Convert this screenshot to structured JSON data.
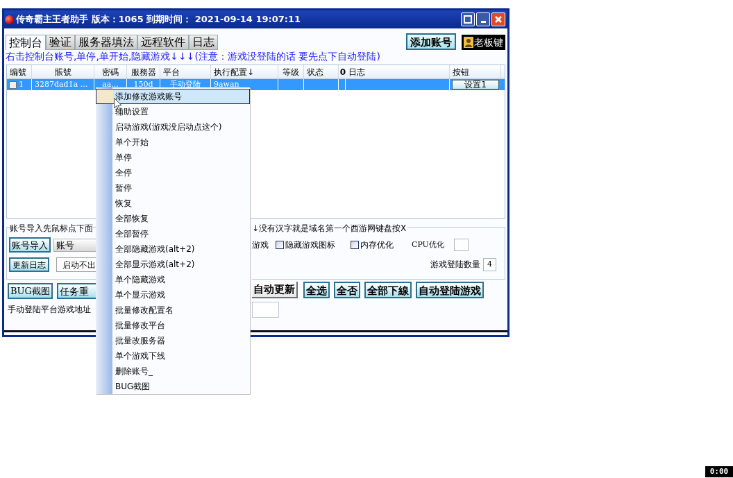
{
  "window": {
    "title": "传奇霸主王者助手 版本：1065 到期时间： 2021-09-14 19:07:11"
  },
  "tabs": [
    {
      "label": "控制台",
      "selected": true
    },
    {
      "label": "验证",
      "selected": false
    },
    {
      "label": "服务器填法",
      "selected": false
    },
    {
      "label": "远程软件",
      "selected": false
    },
    {
      "label": "日志",
      "selected": false
    }
  ],
  "add_account_button": "添加账号",
  "boss_key_button": "老板键",
  "notice": "右击控制台账号,单停,单开始,隐藏游戏↓↓↓(注意：游戏没登陆的话 要先点下自动登陆)",
  "table": {
    "columns": [
      "编號",
      "賬號",
      "密碼",
      "服務器",
      "平台",
      "执行配置↓",
      "等级",
      "状态",
      "0",
      "日志",
      "按钮"
    ],
    "rows": [
      {
        "selected": true,
        "checked": false,
        "cells": [
          "1",
          "3287dad1a ...",
          "aa...",
          "150d",
          "手动登陆",
          "9awan",
          "",
          "",
          "",
          ""
        ],
        "button": "设置1"
      }
    ]
  },
  "left_panel": {
    "group_title": "账号导入先鼠标点下面",
    "import_button": "账号导入",
    "account_combo": "账号",
    "update_log_button": "更新日志",
    "start_button": "启动不出",
    "bug_button": "BUG截图",
    "task_button": "任务重",
    "address_label": "手动登陆平台游戏地址"
  },
  "right_panel": {
    "group_title": "↓没有汉字就是域名第一个西游网键盘按X",
    "cut_label": "游戏",
    "options": [
      {
        "label": "隐藏游戏图标",
        "checked": false
      },
      {
        "label": "内存优化",
        "checked": false
      }
    ],
    "cpu_label": "CPU优化",
    "login_count_label": "游戏登陆数量",
    "login_count": "4",
    "buttons": [
      {
        "label": "自动更新",
        "kind": "plain"
      },
      {
        "label": "全选",
        "kind": "cyan"
      },
      {
        "label": "全否",
        "kind": "cyan"
      },
      {
        "label": "全部下線",
        "kind": "cyan"
      },
      {
        "label": "自动登陆游戏",
        "kind": "cyan"
      }
    ]
  },
  "context_menu": [
    {
      "label": "添加修改游戏账号",
      "selected": true
    },
    {
      "label": "辅助设置",
      "selected": false
    },
    {
      "label": "启动游戏(游戏没启动点这个)",
      "selected": false
    },
    {
      "label": "单个开始",
      "selected": false
    },
    {
      "label": "单停",
      "selected": false
    },
    {
      "label": "全停",
      "selected": false
    },
    {
      "label": "暂停",
      "selected": false
    },
    {
      "label": "恢复",
      "selected": false
    },
    {
      "label": "全部恢复",
      "selected": false
    },
    {
      "label": "全部暂停",
      "selected": false
    },
    {
      "label": "全部隐藏游戏(alt+2)",
      "selected": false
    },
    {
      "label": "全部显示游戏(alt+2)",
      "selected": false
    },
    {
      "label": "单个隐藏游戏",
      "selected": false
    },
    {
      "label": "单个显示游戏",
      "selected": false
    },
    {
      "label": "批量修改配置名",
      "selected": false
    },
    {
      "label": "批量修改平台",
      "selected": false
    },
    {
      "label": "批量改服务器",
      "selected": false
    },
    {
      "label": "单个游戏下线",
      "selected": false
    },
    {
      "label": "删除账号_",
      "selected": false
    },
    {
      "label": "BUG截图",
      "selected": false
    }
  ],
  "timer": "0:00"
}
